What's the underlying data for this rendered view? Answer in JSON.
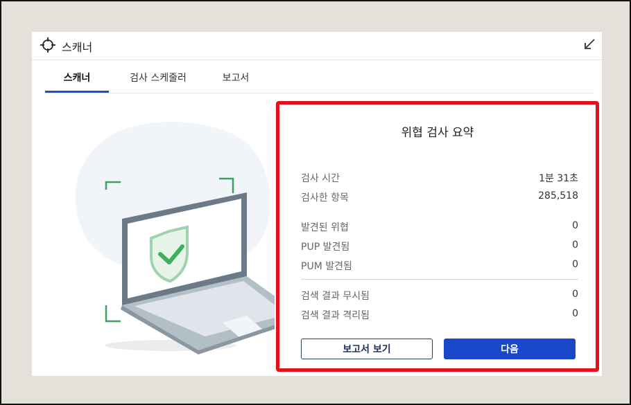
{
  "window": {
    "title": "스캐너",
    "icons": {
      "app": "crosshair-icon",
      "collapse": "arrow-collapse-icon"
    }
  },
  "tabs": [
    {
      "label": "스캐너",
      "active": true
    },
    {
      "label": "검사 스케줄러",
      "active": false
    },
    {
      "label": "보고서",
      "active": false
    }
  ],
  "summary": {
    "title": "위협 검사 요약",
    "rows": [
      {
        "label": "검사 시간",
        "value": "1분 31초"
      },
      {
        "label": "검사한 항목",
        "value": "285,518"
      },
      {
        "label": "발견된 위협",
        "value": "0"
      },
      {
        "label": "PUP 발견됨",
        "value": "0"
      },
      {
        "label": "PUM 발견됨",
        "value": "0"
      },
      {
        "label": "검색 결과 무시됨",
        "value": "0"
      },
      {
        "label": "검색 결과 격리됨",
        "value": "0"
      }
    ],
    "buttons": {
      "report": "보고서 보기",
      "next": "다음"
    }
  },
  "colors": {
    "accent": "#1847c9",
    "highlight_border": "#e3101e",
    "shield_green": "#3fae5c"
  }
}
